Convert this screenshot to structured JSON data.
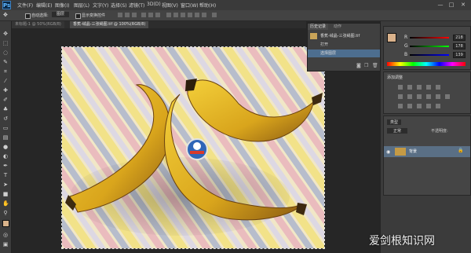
{
  "app": {
    "logo": "Ps"
  },
  "menu": {
    "items": [
      "文件(F)",
      "编辑(E)",
      "图像(I)",
      "图层(L)",
      "文字(Y)",
      "选择(S)",
      "滤镜(T)",
      "3D(D)",
      "视图(V)",
      "窗口(W)",
      "帮助(H)"
    ]
  },
  "window_controls": {
    "minimize": "—",
    "restore": "□",
    "close": "✕"
  },
  "options": {
    "auto_select": "自动选择:",
    "auto_select_value": "图层",
    "show_transform": "显示变换控件"
  },
  "tabs": [
    {
      "label": "未标题-1 @ 50%(RGB/8)"
    },
    {
      "label": "香蕉-绒晶-三张绳图.tif @ 100%(RGB/8)"
    }
  ],
  "history": {
    "tabs": [
      "历史记录",
      "动作"
    ],
    "items": [
      {
        "label": "香蕉-绒晶-三张绳图.tif"
      },
      {
        "label": "打开"
      },
      {
        "label": "选择图层"
      }
    ]
  },
  "color_panel": {
    "r_label": "R",
    "g_label": "G",
    "b_label": "B",
    "r": "218",
    "g": "178",
    "b": "139"
  },
  "adjustments": {
    "title": "添加调整"
  },
  "layers": {
    "kind": "类型",
    "blend": "正常",
    "opacity_label": "不透明度:",
    "layer_name": "背景"
  },
  "colors": {
    "bg": "#262626",
    "panel": "#404040",
    "selected": "#4d6e8f"
  },
  "watermark": "爱剑根知识网"
}
